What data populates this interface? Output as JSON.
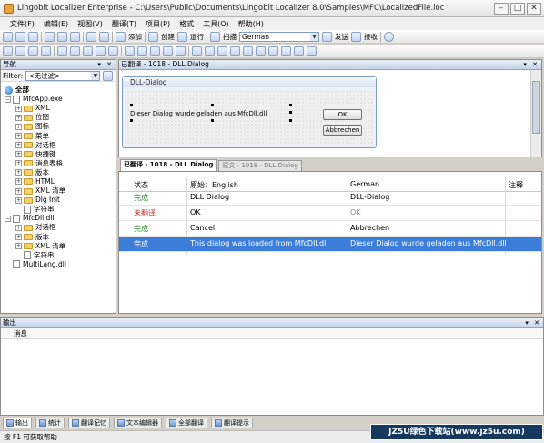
{
  "window": {
    "title": "Lingobit Localizer Enterprise - C:\\Users\\Public\\Documents\\Lingobit Localizer 8.0\\Samples\\MFC\\LocalizedFile.loc"
  },
  "menu": [
    "文件(F)",
    "编辑(E)",
    "视图(V)",
    "翻译(T)",
    "项目(P)",
    "格式",
    "工具(O)",
    "帮助(H)"
  ],
  "toolbar": {
    "add_label": "添加",
    "create_label": "创建",
    "run_label": "运行",
    "scan_label": "扫描",
    "language_value": "German",
    "send_label": "发送",
    "receive_label": "接收"
  },
  "nav": {
    "title": "导航",
    "filter_label": "Filter:",
    "filter_value": "<无过滤>",
    "tree": [
      {
        "label": "全部"
      },
      {
        "label": "MfcApp.exe"
      },
      {
        "label": "XML"
      },
      {
        "label": "位图"
      },
      {
        "label": "图标"
      },
      {
        "label": "菜单"
      },
      {
        "label": "对话框"
      },
      {
        "label": "快捷键"
      },
      {
        "label": "消息表格"
      },
      {
        "label": "版本"
      },
      {
        "label": "HTML"
      },
      {
        "label": "XML 清单"
      },
      {
        "label": "Dlg Init"
      },
      {
        "label": "字符串"
      },
      {
        "label": "MfcDll.dll"
      },
      {
        "label": "对话框"
      },
      {
        "label": "版本"
      },
      {
        "label": "XML 清单"
      },
      {
        "label": "字符串"
      },
      {
        "label": "MultiLang.dll"
      }
    ]
  },
  "preview": {
    "header": "已翻译 - 1018 - DLL Dialog",
    "dialog_title": "DLL-Dialog",
    "dialog_message": "Dieser Dialog wurde geladen aus MfcDll.dll",
    "ok_button": "OK",
    "cancel_button": "Abbrechen"
  },
  "tabs": {
    "translated": "已翻译 - 1018 - DLL Dialog",
    "original": "原文 - 1018 - DLL Dialog"
  },
  "grid": {
    "columns": [
      "状态",
      "原始：English",
      "German",
      "注释"
    ],
    "rows": [
      {
        "status": "完成",
        "original": "DLL Dialog",
        "german": "DLL-Dialog",
        "comment": ""
      },
      {
        "status": "未翻译",
        "original": "OK",
        "german": "OK",
        "comment": ""
      },
      {
        "status": "完成",
        "original": "Cancel",
        "german": "Abbrechen",
        "comment": ""
      },
      {
        "status": "完成",
        "original": "This dialog was loaded from MfcDll.dll",
        "german": "Dieser Dialog wurde geladen aus MfcDll.dll",
        "comment": ""
      }
    ],
    "colors": {
      "done": "#2a8a2a",
      "untranslated": "#c0302a",
      "selected": "#3b7dd8"
    }
  },
  "output": {
    "title": "输出",
    "column": "消息"
  },
  "bottom_tabs": [
    "输出",
    "统计",
    "翻译记忆",
    "文本编辑器",
    "全部翻译",
    "翻译提示"
  ],
  "status": {
    "text": "按 F1 可获取帮助"
  },
  "watermark": "JZ5U绿色下载站(www.jz5u.com)"
}
